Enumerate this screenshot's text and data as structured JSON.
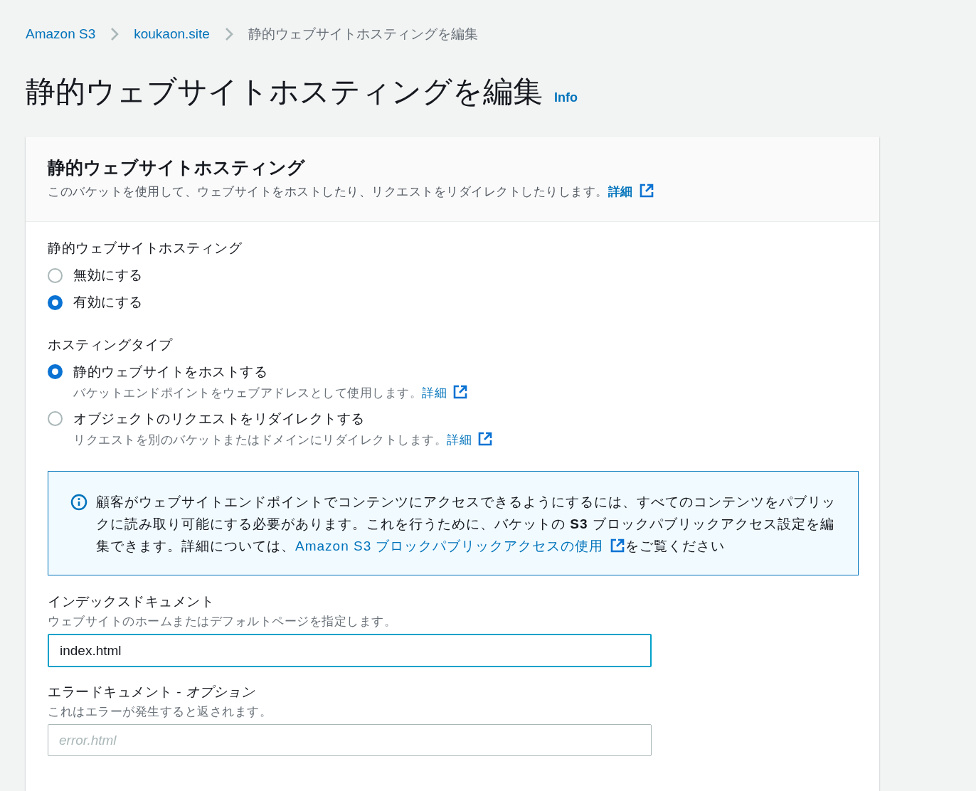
{
  "breadcrumbs": [
    {
      "label": "Amazon S3",
      "link": true
    },
    {
      "label": "koukaon.site",
      "link": true
    },
    {
      "label": "静的ウェブサイトホスティングを編集",
      "link": false
    }
  ],
  "page_title": "静的ウェブサイトホスティングを編集",
  "info_link": "Info",
  "panel": {
    "title": "静的ウェブサイトホスティング",
    "description": "このバケットを使用して、ウェブサイトをホストしたり、リクエストをリダイレクトしたりします。",
    "description_link": "詳細"
  },
  "radio_groups": [
    {
      "label": "静的ウェブサイトホスティング",
      "options": [
        {
          "label": "無効にする",
          "selected": false
        },
        {
          "label": "有効にする",
          "selected": true
        }
      ]
    },
    {
      "label": "ホスティングタイプ",
      "options": [
        {
          "label": "静的ウェブサイトをホストする",
          "selected": true,
          "description": "バケットエンドポイントをウェブアドレスとして使用します。",
          "link": "詳細"
        },
        {
          "label": "オブジェクトのリクエストをリダイレクトする",
          "selected": false,
          "description": "リクエストを別のバケットまたはドメインにリダイレクトします。",
          "link": "詳細"
        }
      ]
    }
  ],
  "info_alert": {
    "text_before": "顧客がウェブサイトエンドポイントでコンテンツにアクセスできるようにするには、すべてのコンテンツをパブリックに読み取り可能にする必要があります。これを行うために、バケットの **S3** ブロックパブリックアクセス設定を編集できます。詳細については、",
    "link": "Amazon S3 ブロックパブリックアクセスの使用",
    "text_after": "をご覧ください"
  },
  "fields": [
    {
      "label": "インデックスドキュメント",
      "hint": "ウェブサイトのホームまたはデフォルトページを指定します。",
      "value": "index.html",
      "focused": true
    },
    {
      "label": "エラードキュメント - *オプション*",
      "hint": "これはエラーが発生すると返されます。",
      "placeholder": "error.html",
      "focused": false
    }
  ]
}
